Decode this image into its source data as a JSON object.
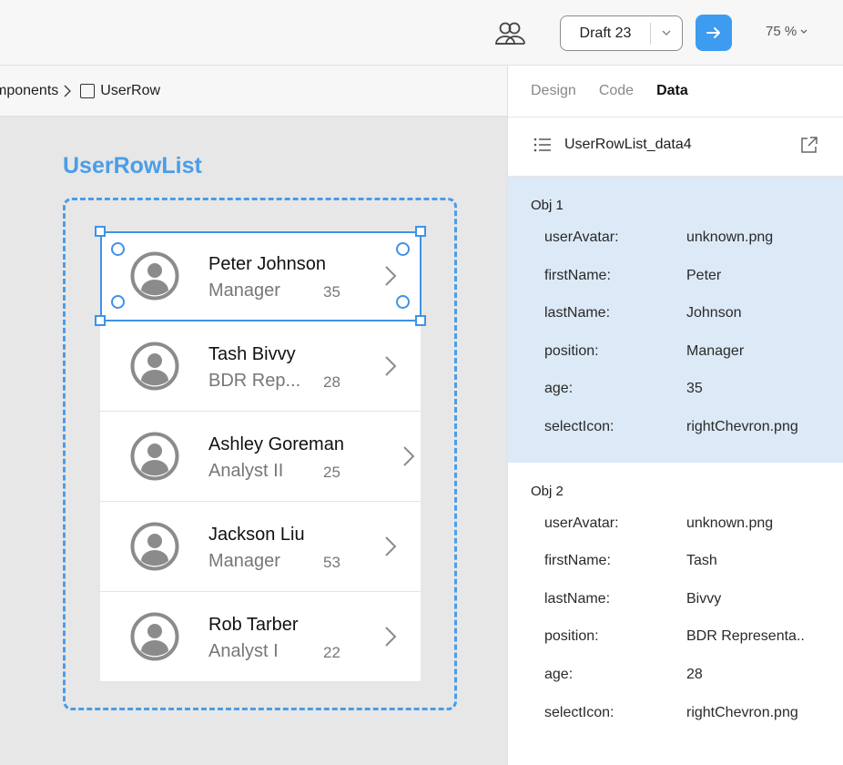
{
  "toolbar": {
    "draft_label": "Draft 23",
    "zoom_label": "75 %",
    "accent": "#3d9cf0"
  },
  "breadcrumb": {
    "parent": "mponents",
    "current": "UserRow"
  },
  "canvas": {
    "component_title": "UserRowList",
    "rows": [
      {
        "name": "Peter Johnson",
        "position": "Manager",
        "age": "35"
      },
      {
        "name": "Tash Bivvy",
        "position": "BDR Rep...",
        "age": "28"
      },
      {
        "name": "Ashley Goreman",
        "position": "Analyst II",
        "age": "25"
      },
      {
        "name": "Jackson Liu",
        "position": "Manager",
        "age": "53"
      },
      {
        "name": "Rob Tarber",
        "position": "Analyst I",
        "age": "22"
      }
    ]
  },
  "panel": {
    "tabs": [
      {
        "label": "Design"
      },
      {
        "label": "Code"
      },
      {
        "label": "Data"
      }
    ],
    "dataset_name": "UserRowList_data4",
    "objects": [
      {
        "title": "Obj 1",
        "fields": [
          {
            "key": "userAvatar:",
            "value": "unknown.png"
          },
          {
            "key": "firstName:",
            "value": "Peter"
          },
          {
            "key": "lastName:",
            "value": "Johnson"
          },
          {
            "key": "position:",
            "value": "Manager"
          },
          {
            "key": "age:",
            "value": "35"
          },
          {
            "key": "selectIcon:",
            "value": "rightChevron.png"
          }
        ]
      },
      {
        "title": "Obj 2",
        "fields": [
          {
            "key": "userAvatar:",
            "value": "unknown.png"
          },
          {
            "key": "firstName:",
            "value": "Tash"
          },
          {
            "key": "lastName:",
            "value": "Bivvy"
          },
          {
            "key": "position:",
            "value": "BDR Representa.."
          },
          {
            "key": "age:",
            "value": "28"
          },
          {
            "key": "selectIcon:",
            "value": "rightChevron.png"
          }
        ]
      }
    ]
  }
}
